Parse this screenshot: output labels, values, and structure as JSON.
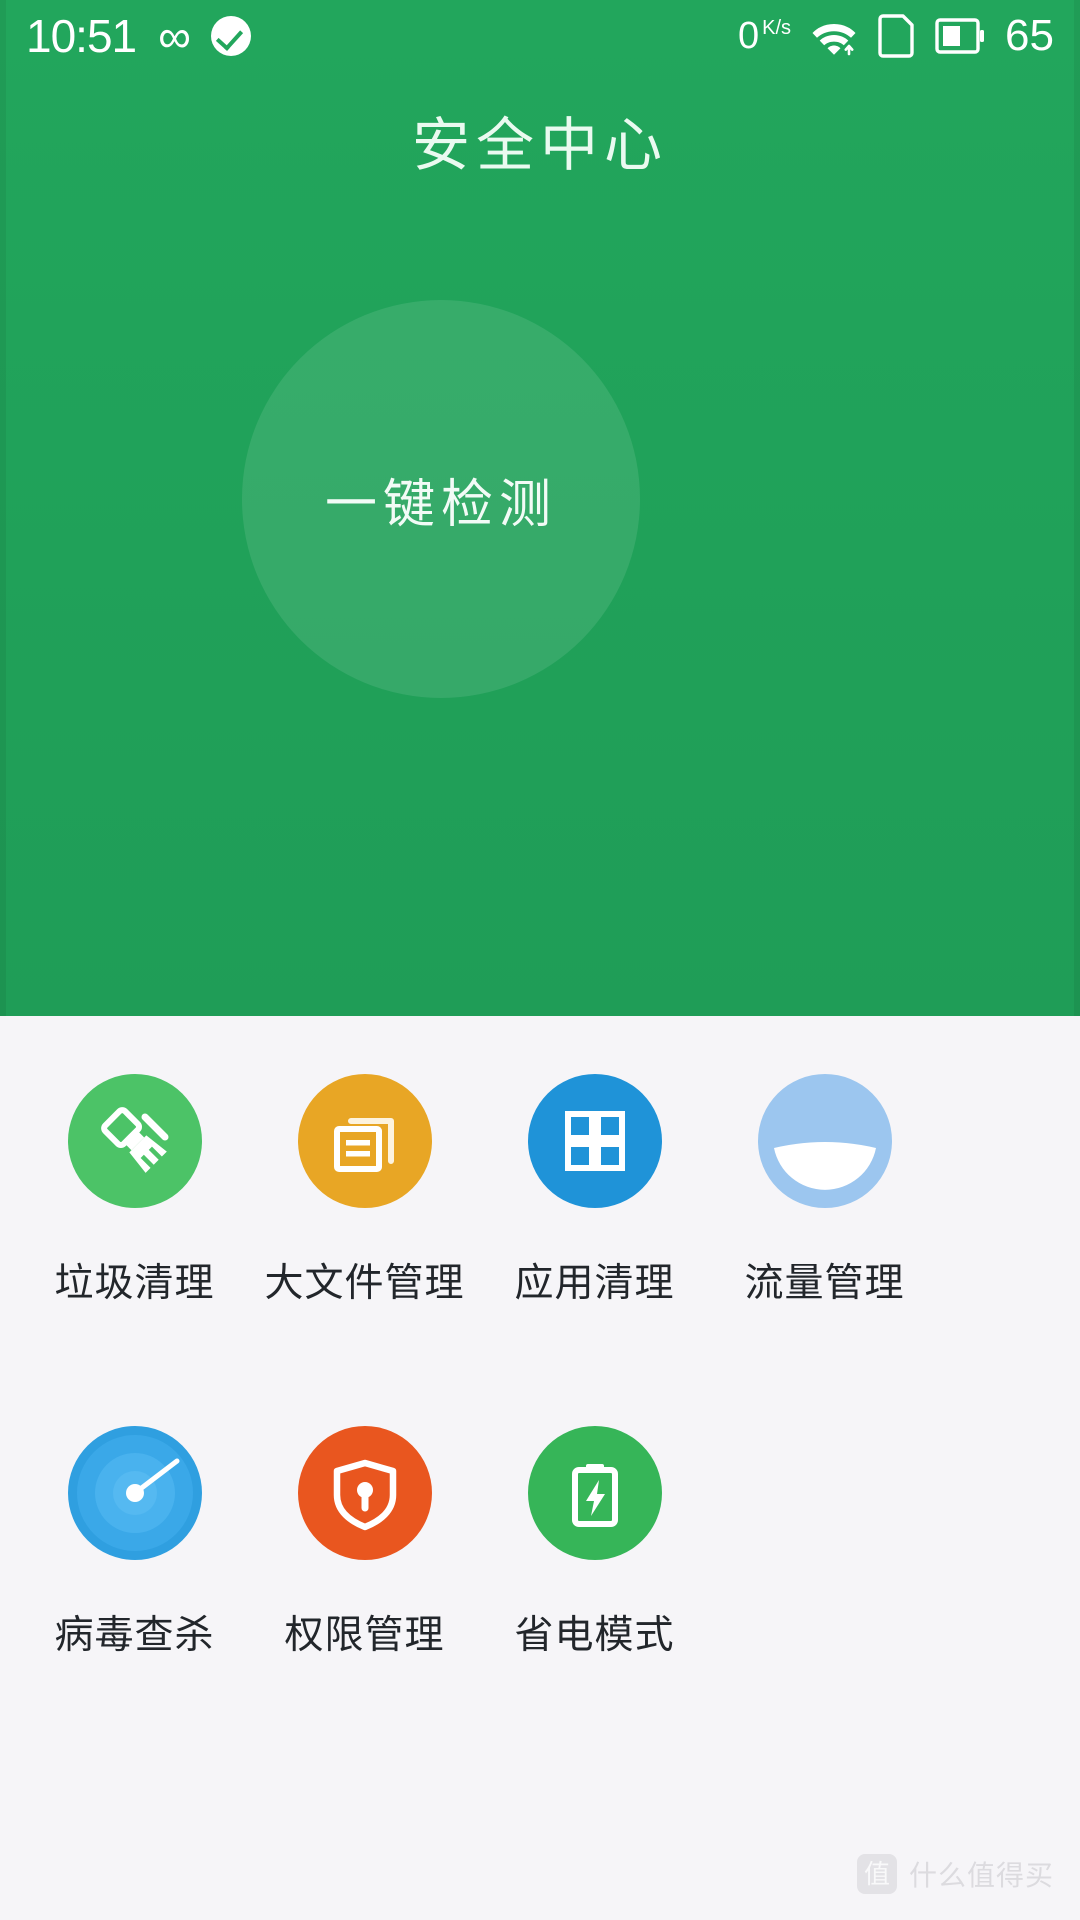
{
  "status_bar": {
    "time": "10:51",
    "infinity_icon": "infinity-icon",
    "check_icon": "check-badge-icon",
    "net_speed": "0",
    "net_speed_unit": "K/s",
    "wifi_icon": "wifi-icon",
    "sim_icon": "sim-card-icon",
    "battery_icon": "battery-icon",
    "battery_level": "65"
  },
  "header": {
    "title": "安全中心",
    "bg_color": "#22a65c"
  },
  "scan": {
    "label": "一键检测",
    "circle_color": "rgba(255,255,255,0.10)"
  },
  "grid": {
    "rows": [
      [
        {
          "label": "垃圾清理",
          "icon": "broom-icon",
          "color": "#4cc367"
        },
        {
          "label": "大文件管理",
          "icon": "documents-icon",
          "color": "#e8a625"
        },
        {
          "label": "应用清理",
          "icon": "grid-squares-icon",
          "color": "#1f93d8"
        },
        {
          "label": "流量管理",
          "icon": "data-meter-icon",
          "color": "#9cc6ef"
        }
      ],
      [
        {
          "label": "病毒查杀",
          "icon": "radar-scan-icon",
          "color": "#2f9fe0"
        },
        {
          "label": "权限管理",
          "icon": "shield-lock-icon",
          "color": "#e9561f"
        },
        {
          "label": "省电模式",
          "icon": "battery-bolt-icon",
          "color": "#36b558"
        }
      ]
    ]
  },
  "watermark": {
    "badge": "值",
    "text": "什么值得买"
  }
}
